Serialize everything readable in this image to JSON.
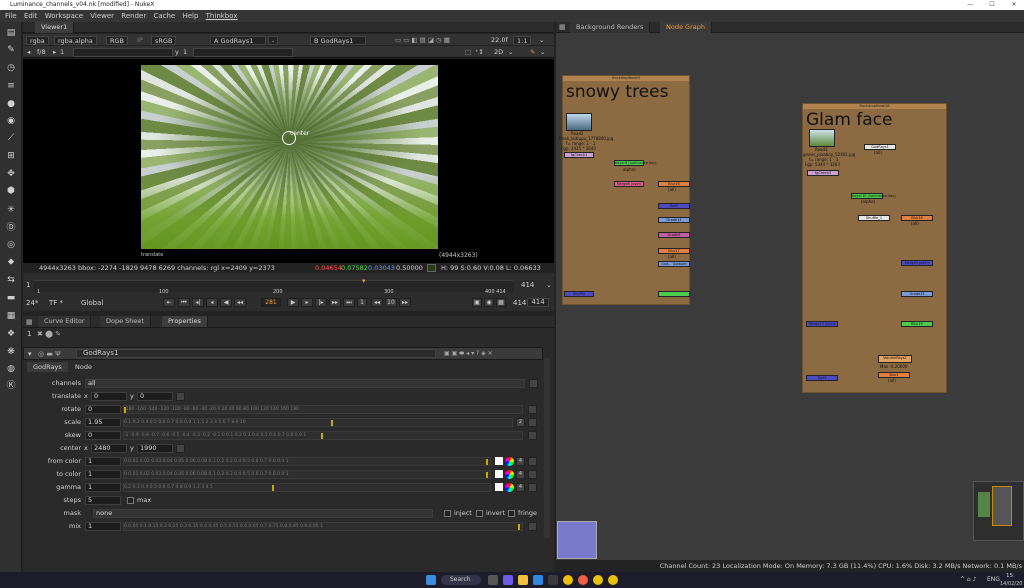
{
  "window": {
    "title": "Luminance_channels_v04.nk [modified] - NukeX"
  },
  "menu": [
    "File",
    "Edit",
    "Workspace",
    "Viewer",
    "Render",
    "Cache",
    "Help",
    "Thinkbox"
  ],
  "viewer": {
    "tab": "Viewer1",
    "channels": "rgba",
    "alpha": "rgba.alpha",
    "colorspace_a": "RGB",
    "ip": "IP",
    "lut": "sRGB",
    "input_a": "A  GodRays1",
    "a_extra": "-",
    "input_b": "B  GodRays1",
    "fstop": "22.0f",
    "zoom": "1:1",
    "gain_label": "f/8",
    "gain_value": "1",
    "y_label": "y",
    "y_value": "1",
    "mode_2d": "2D",
    "overlay_center": "center",
    "overlay_translate": "translate",
    "format_label": "(4944x3263)",
    "info": {
      "res": "4944x3263",
      "bbox": "bbox: -2274 -1829 9478 6269 channels: rgl x=2409 y=2373",
      "r": "0.04654",
      "g": "0.07582",
      "b": "0.03043",
      "a": "0.50000",
      "hsvl": "H: 99 S:0.60 V:0.08  L: 0.06633"
    },
    "timeline": {
      "start": "1",
      "end": "414",
      "current": "281",
      "ticks": [
        "1",
        "100",
        "200",
        "300",
        "400 414"
      ],
      "fps": "24*",
      "tf": "TF *",
      "range": "Global",
      "frame_field": "281",
      "inc": "10",
      "in_out": "1",
      "end_field": "414",
      "end_field2": "414"
    }
  },
  "panels": {
    "tabs": [
      "Curve Editor",
      "Dope Sheet",
      "Properties"
    ]
  },
  "props": {
    "node_name": "GodRays1",
    "tabs": [
      "GodRays",
      "Node"
    ],
    "channels": "all",
    "translate": {
      "label": "translate",
      "x_label": "x",
      "x": "0",
      "y_label": "y",
      "y": "0"
    },
    "rotate": {
      "label": "rotate",
      "value": "0",
      "fraction": 0.0
    },
    "scale": {
      "label": "scale",
      "value": "1.95",
      "fraction": 0.54
    },
    "skew": {
      "label": "skew",
      "value": "0",
      "fraction": 0.5
    },
    "center": {
      "label": "center",
      "x_label": "x",
      "x": "2480",
      "y_label": "y",
      "y": "1990"
    },
    "from_color": {
      "label": "from color",
      "value": "1",
      "fraction": 1.0
    },
    "to_color": {
      "label": "to color",
      "value": "1",
      "fraction": 1.0
    },
    "gamma": {
      "label": "gamma",
      "value": "1",
      "fraction": 0.41
    },
    "steps": {
      "label": "steps",
      "value": "5",
      "max_label": "max"
    },
    "mask": {
      "label": "mask",
      "value": "none",
      "inject": "inject",
      "invert": "invert",
      "fringe": "fringe"
    },
    "mix": {
      "label": "mix",
      "value": "1",
      "fraction": 1.0
    },
    "channels_label": "channels",
    "rotate_ticks": "-180  -160  -140  -120  -100  -80  -60  -40  -20  0  20  40  60  80  100  120  140  160  180",
    "scale_ticks": "0.1     0.2    0.4   0.5  0.6  0.7  0.8  0.9  1     1.5     2     3     4   5  6  7  8  9  10",
    "skew_ticks": "-1   -0.9   -0.8   -0.7   -0.6   -0.5   -0.4   -0.3   -0.2   -0.1   0   0.1   0.2   0.3   0.4   0.5   0.6   0.7   0.8   0.9   1",
    "color_ticks": "0   0.01  0.02  0.03  0.04  0.05  0.06 0.08 0.1     0.2     0.3     0.4     0.5     0.6     0.7     0.8     0.9     1",
    "gamma_ticks": "0.2      0.3      0.4      0.5      0.6  0.7  0.8  0.9  1           2           3           4           5",
    "mix_ticks": "0    0.05   0.1   0.15   0.2   0.25   0.3   0.35   0.4   0.45   0.5   0.55   0.6   0.65   0.7   0.75   0.8   0.85   0.9   0.95   1",
    "channel_count": "4"
  },
  "nodegraph": {
    "tabs": [
      "Background Renders",
      "Node Graph"
    ],
    "bd1": {
      "header": "BackdropNode4",
      "title": "snowy trees"
    },
    "bd2": {
      "header": "BackdropNode16",
      "title": "Glam face"
    },
    "nodes": {
      "read2": "Read2",
      "read2_file": "freak_kubupu_1778840.jpg",
      "read2_range": "f= range: 1 - 1",
      "read2_fmt": "Fgp: 2425 * 1640",
      "fgcheck2": "fgCheck1",
      "keyer1": "Keyer9 (luminance key)",
      "keyer1_b": "alpha)",
      "blur16": "Blur16",
      "blur16_b": "(all)",
      "merge1": "Merge8 (over)",
      "grade14": "Grade14",
      "grade5": "Grade5",
      "blur17": "Blur17",
      "blur17_b": "(all)",
      "god_godown": "God... Godown",
      "dot2": "Dot2",
      "shuffle": "Shuffle",
      "read3": "Read3",
      "read3_file": "grenis_pixabay_52401.jpg",
      "read3_range": "f= range: 1 - 1",
      "read3_fmt": "Fgp: 5344 * 3263",
      "godrays1": "GodRays1",
      "godrays1_b": "(all)",
      "fgcheck3": "fgCheck3",
      "keyer2": "Keyer10 (luminance key)",
      "keyer2_b": "(alpha)",
      "shuffle2": "Shuffle_1",
      "blur18": "Blur18",
      "blur18_b": "(all)",
      "merge2": "Merge9 (over)",
      "grade15": "Grade15",
      "blur19": "Blur19",
      "merge3": "Merge10 (over)",
      "merge4": "Merge11",
      "volume_a": "VolumeRays1",
      "volume_b": "Max: 0.20000",
      "blur_n": "Blur1",
      "blur_n_b": "(all)",
      "dot3": "Dot3"
    }
  },
  "status": "Channel Count: 23  Localization Mode: On  Memory: 7.3 GB (11.4%)  CPU: 1.6%  Disk: 3.2 MB/s  Network: 0.1 MB/s",
  "taskbar": {
    "search": "Search",
    "time": "15:",
    "date": "14/02/20",
    "lang": "ENG"
  }
}
